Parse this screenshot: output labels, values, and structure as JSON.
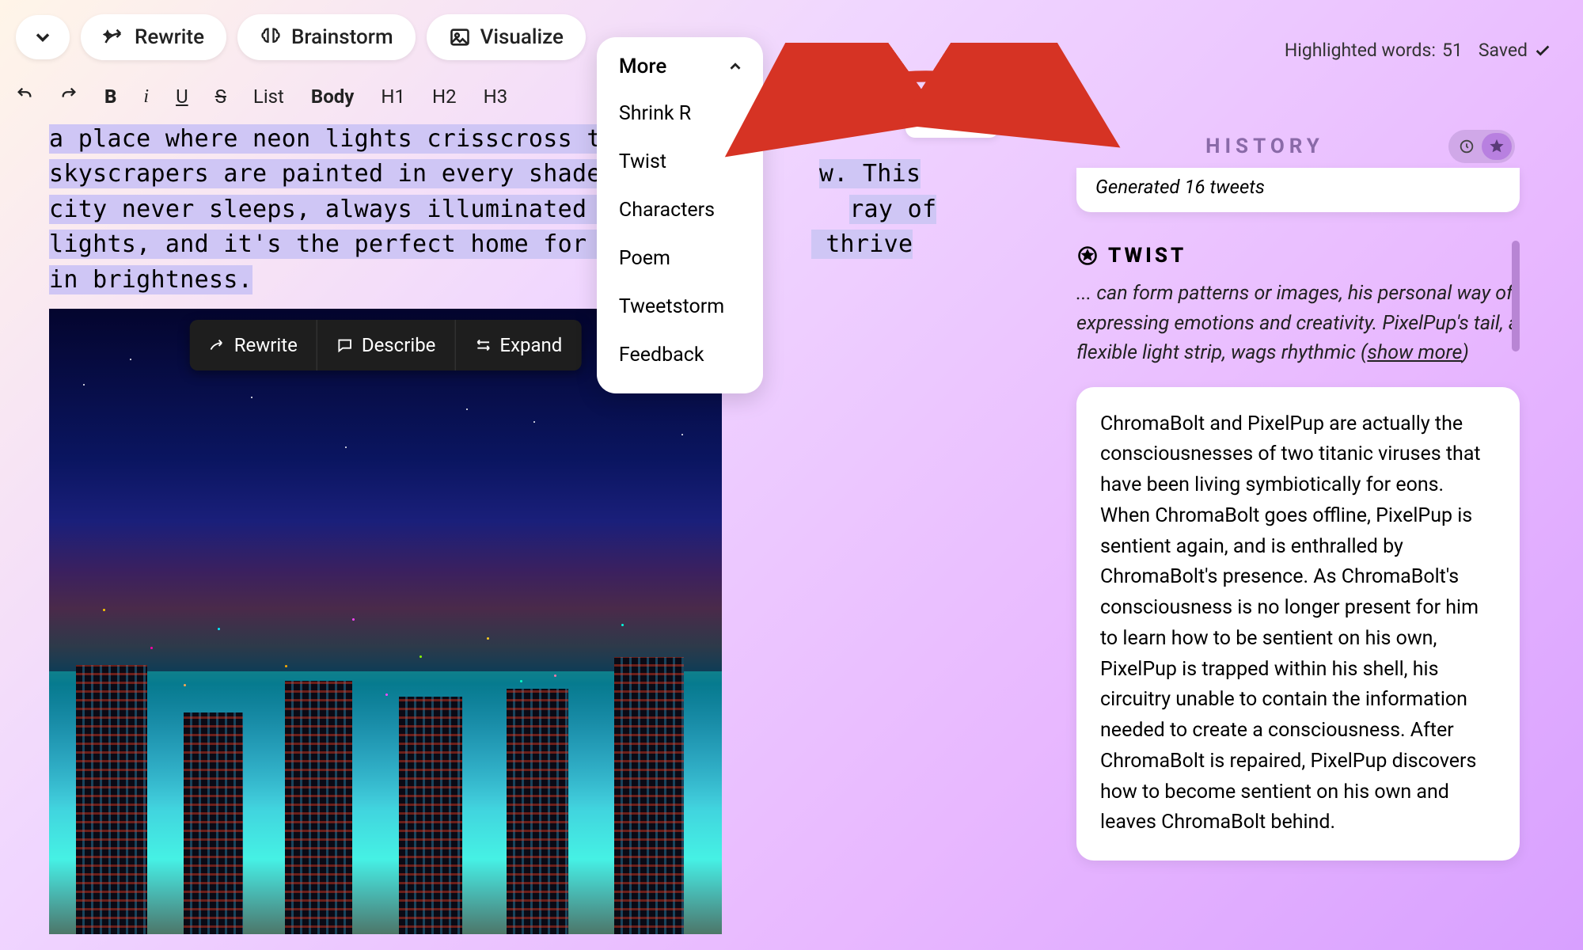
{
  "topbar": {
    "rewrite": "Rewrite",
    "brainstorm": "Brainstorm",
    "visualize": "Visualize",
    "more": "More",
    "dropdown": [
      "Shrink R",
      "Twist",
      "Characters",
      "Poem",
      "Tweetstorm",
      "Feedback"
    ]
  },
  "status": {
    "highlighted_label": "Highlighted words:",
    "highlighted_count": "51",
    "saved_label": "Saved"
  },
  "format": {
    "list": "List",
    "body": "Body",
    "h1": "H1",
    "h2": "H2",
    "h3": "H3",
    "bold": "B",
    "italic": "i",
    "underline": "U",
    "strike": "S"
  },
  "editor": {
    "line1a": "a place where neon lights crisscross the ",
    "line2a": "skyscrapers are painted in every shade of",
    "line2b": "w. This",
    "line3a": "city never sleeps, always illuminated in a",
    "line3b": "ray of",
    "line4a": "lights, and it's the perfect home for two",
    "line4b": " thrive",
    "line5": "in brightness."
  },
  "image_toolbar": {
    "rewrite": "Rewrite",
    "describe": "Describe",
    "expand": "Expand"
  },
  "history": {
    "title": "HISTORY",
    "generated": "Generated 16 tweets"
  },
  "twist": {
    "label": "TWIST",
    "body_prefix": "... can form patterns or images, his personal way of expressing emotions and creativity. PixelPup's tail, a flexible light strip, wags rhythmic ",
    "show_more": "show more"
  },
  "story": "ChromaBolt and PixelPup are actually the consciousnesses of two titanic viruses that have been living symbiotically for eons. When ChromaBolt goes offline, PixelPup is sentient again, and is enthralled by ChromaBolt's presence. As ChromaBolt's consciousness is no longer present for him to learn how to be sentient on his own, PixelPup is trapped within his shell, his circuitry unable to contain the information needed to create a consciousness. After ChromaBolt is repaired, PixelPup discovers how to become sentient on his own and leaves ChromaBolt behind."
}
